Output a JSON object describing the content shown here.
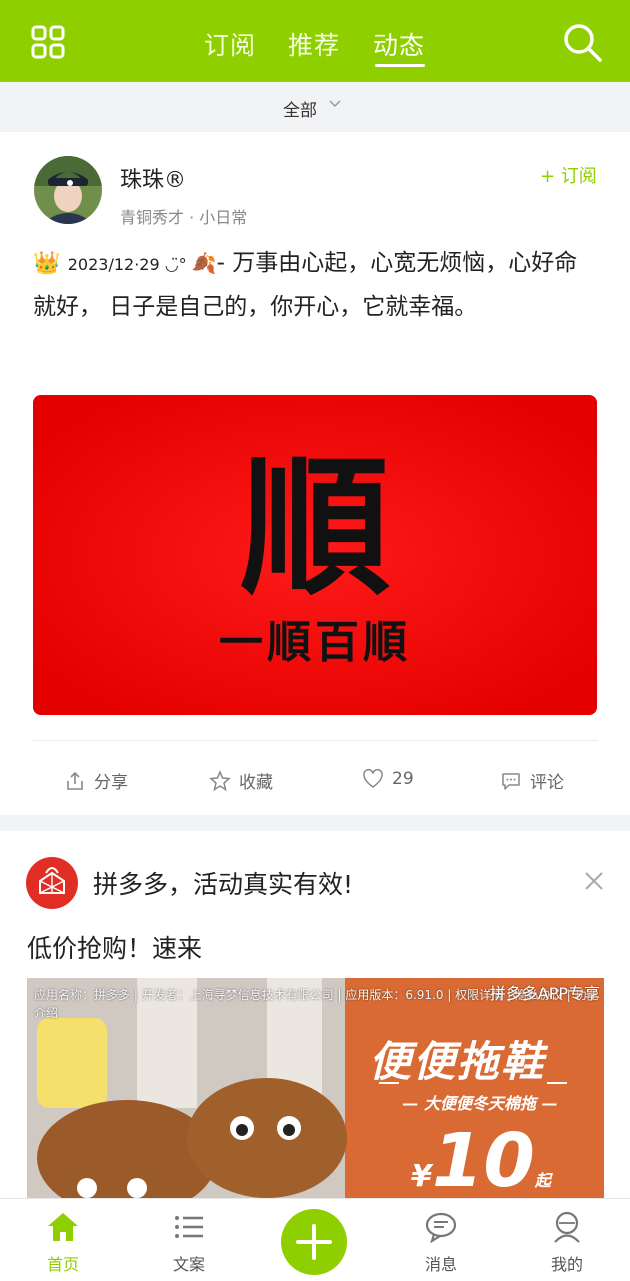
{
  "header": {
    "tabs": [
      {
        "label": "订阅",
        "active": false
      },
      {
        "label": "推荐",
        "active": false
      },
      {
        "label": "动态",
        "active": true
      }
    ],
    "left_icon": "grid-icon",
    "right_icon": "search-icon",
    "accent_color": "#8fcf00"
  },
  "filter": {
    "label": "全部",
    "icon": "chevron-down-icon"
  },
  "post": {
    "user": {
      "name": "珠珠®",
      "meta": "青铜秀才 · 小日常"
    },
    "subscribe_label": "+ 订阅",
    "text_prefix": "2023/12·29 ◡̈° ",
    "text": "- 万事由心起，心宽无烦恼，心好命就好， 日子是自己的，你开心，它就幸福。",
    "image": {
      "main_char": "順",
      "caption": "一順百順"
    },
    "actions": [
      {
        "icon": "share-icon",
        "label": "分享"
      },
      {
        "icon": "star-icon",
        "label": "收藏"
      },
      {
        "icon": "heart-icon",
        "label": "29"
      },
      {
        "icon": "comment-icon",
        "label": "评论"
      }
    ]
  },
  "ad": {
    "title": "拼多多，活动真实有效!",
    "subtitle": "低价抢购！速来",
    "image_info": "应用名称：拼多多 | 开发者：上海寻梦信息技术有限公司 | 应用版本：6.91.0 | 权限详情 | 隐私协议 | 功能介绍",
    "tag": "拼多多APP专享",
    "promo_title": "便便拖鞋",
    "promo_sub": "— 大便便冬天棉拖 —",
    "price_currency": "¥",
    "price_value": "10",
    "price_suffix": "起"
  },
  "bottom_nav": {
    "items": [
      {
        "label": "首页",
        "icon": "home-icon",
        "active": true
      },
      {
        "label": "文案",
        "icon": "list-icon",
        "active": false
      },
      {
        "label": "消息",
        "icon": "message-icon",
        "active": false
      },
      {
        "label": "我的",
        "icon": "profile-icon",
        "active": false
      }
    ],
    "center_icon": "add-icon"
  }
}
